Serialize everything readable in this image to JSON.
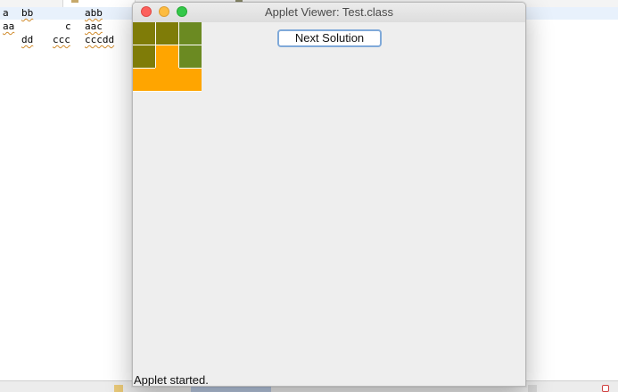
{
  "editor": {
    "lines": [
      {
        "cols": [
          {
            "text": "a",
            "sq": false
          },
          {
            "text": "bb",
            "sq": true
          },
          {
            "text": "abb",
            "sq": true
          }
        ]
      },
      {
        "cols": [
          {
            "text": "aa",
            "sq": true
          },
          {
            "text": "c",
            "sq": false
          },
          {
            "text": "aac",
            "sq": true
          }
        ]
      },
      {
        "cols": [
          {
            "text": "dd",
            "sq": true
          },
          {
            "text": "ccc",
            "sq": true
          },
          {
            "text": "cccdd",
            "sq": true
          }
        ]
      }
    ]
  },
  "window": {
    "title": "Applet Viewer: Test.class"
  },
  "applet": {
    "next_button_label": "Next Solution",
    "status_text": "Applet started.",
    "grid": {
      "rows": 3,
      "cols": 3,
      "cells": [
        [
          "olive",
          "olive",
          "green"
        ],
        [
          "olive",
          "orange",
          "green"
        ],
        [
          "orange",
          "orange",
          "orange"
        ]
      ]
    }
  },
  "colors": {
    "olive": "#7f7c08",
    "green": "#6b8a22",
    "orange": "#ffa500",
    "grid_line": "#ffffff",
    "button_focus": "#7fa9d9",
    "close": "#fc605c",
    "minimize": "#fdbc40",
    "maximize": "#34c84a"
  }
}
